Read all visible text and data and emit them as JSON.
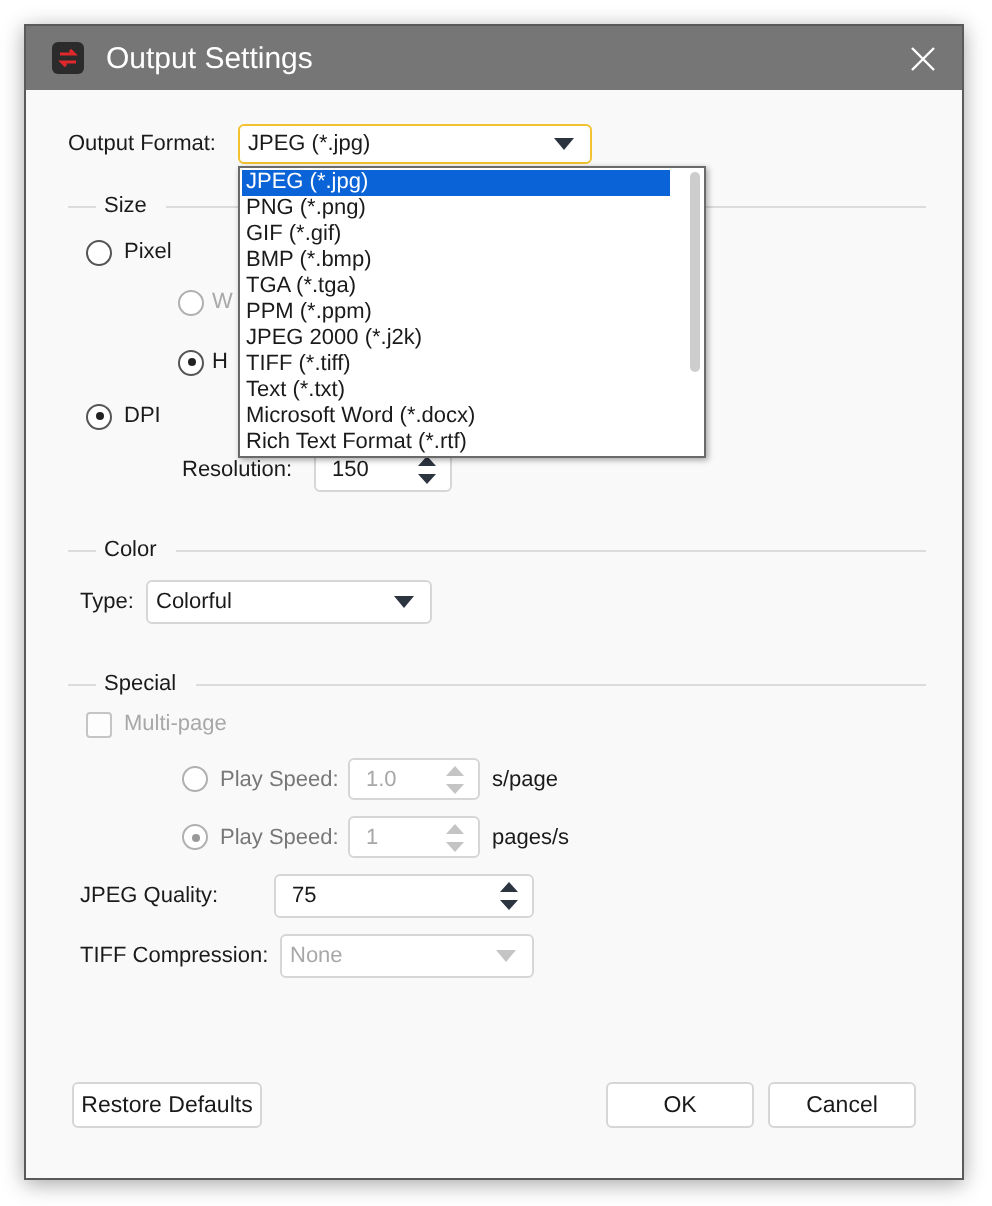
{
  "window": {
    "title": "Output Settings"
  },
  "output_format": {
    "label": "Output Format:",
    "value": "JPEG (*.jpg)",
    "focused": true
  },
  "format_list": [
    {
      "label": "JPEG (*.jpg)",
      "selected": true
    },
    {
      "label": "PNG (*.png)",
      "selected": false
    },
    {
      "label": "GIF (*.gif)",
      "selected": false
    },
    {
      "label": "BMP (*.bmp)",
      "selected": false
    },
    {
      "label": "TGA (*.tga)",
      "selected": false
    },
    {
      "label": "PPM (*.ppm)",
      "selected": false
    },
    {
      "label": "JPEG 2000 (*.j2k)",
      "selected": false
    },
    {
      "label": "TIFF (*.tiff)",
      "selected": false
    },
    {
      "label": "Text (*.txt)",
      "selected": false
    },
    {
      "label": "Microsoft Word (*.docx)",
      "selected": false
    },
    {
      "label": "Rich Text Format (*.rtf)",
      "selected": false
    }
  ],
  "size": {
    "title": "Size",
    "pixel": {
      "label": "Pixel",
      "selected": false
    },
    "pixel_options": [
      {
        "label": "W",
        "selected": false,
        "disabled": true
      },
      {
        "label": "H",
        "selected": true,
        "disabled": false
      }
    ],
    "dpi": {
      "label": "DPI",
      "selected": true
    },
    "resolution": {
      "label": "Resolution:",
      "value": "150"
    }
  },
  "color": {
    "title": "Color",
    "type_label": "Type:",
    "type_value": "Colorful"
  },
  "special": {
    "title": "Special",
    "multipage": {
      "label": "Multi-page",
      "checked": false,
      "disabled": true
    },
    "play_speeds": [
      {
        "label": "Play Speed:",
        "value": "1.0",
        "unit": "s/page",
        "selected": false,
        "disabled": true
      },
      {
        "label": "Play Speed:",
        "value": "1",
        "unit": "pages/s",
        "selected": true,
        "disabled": true
      }
    ]
  },
  "jpeg_quality": {
    "label": "JPEG Quality:",
    "value": "75",
    "disabled": false
  },
  "tiff_compression": {
    "label": "TIFF Compression:",
    "value": "None",
    "disabled": true
  },
  "footer": {
    "left": [
      {
        "label": "Restore Defaults"
      }
    ],
    "right": [
      {
        "label": "OK"
      },
      {
        "label": "Cancel"
      }
    ]
  }
}
